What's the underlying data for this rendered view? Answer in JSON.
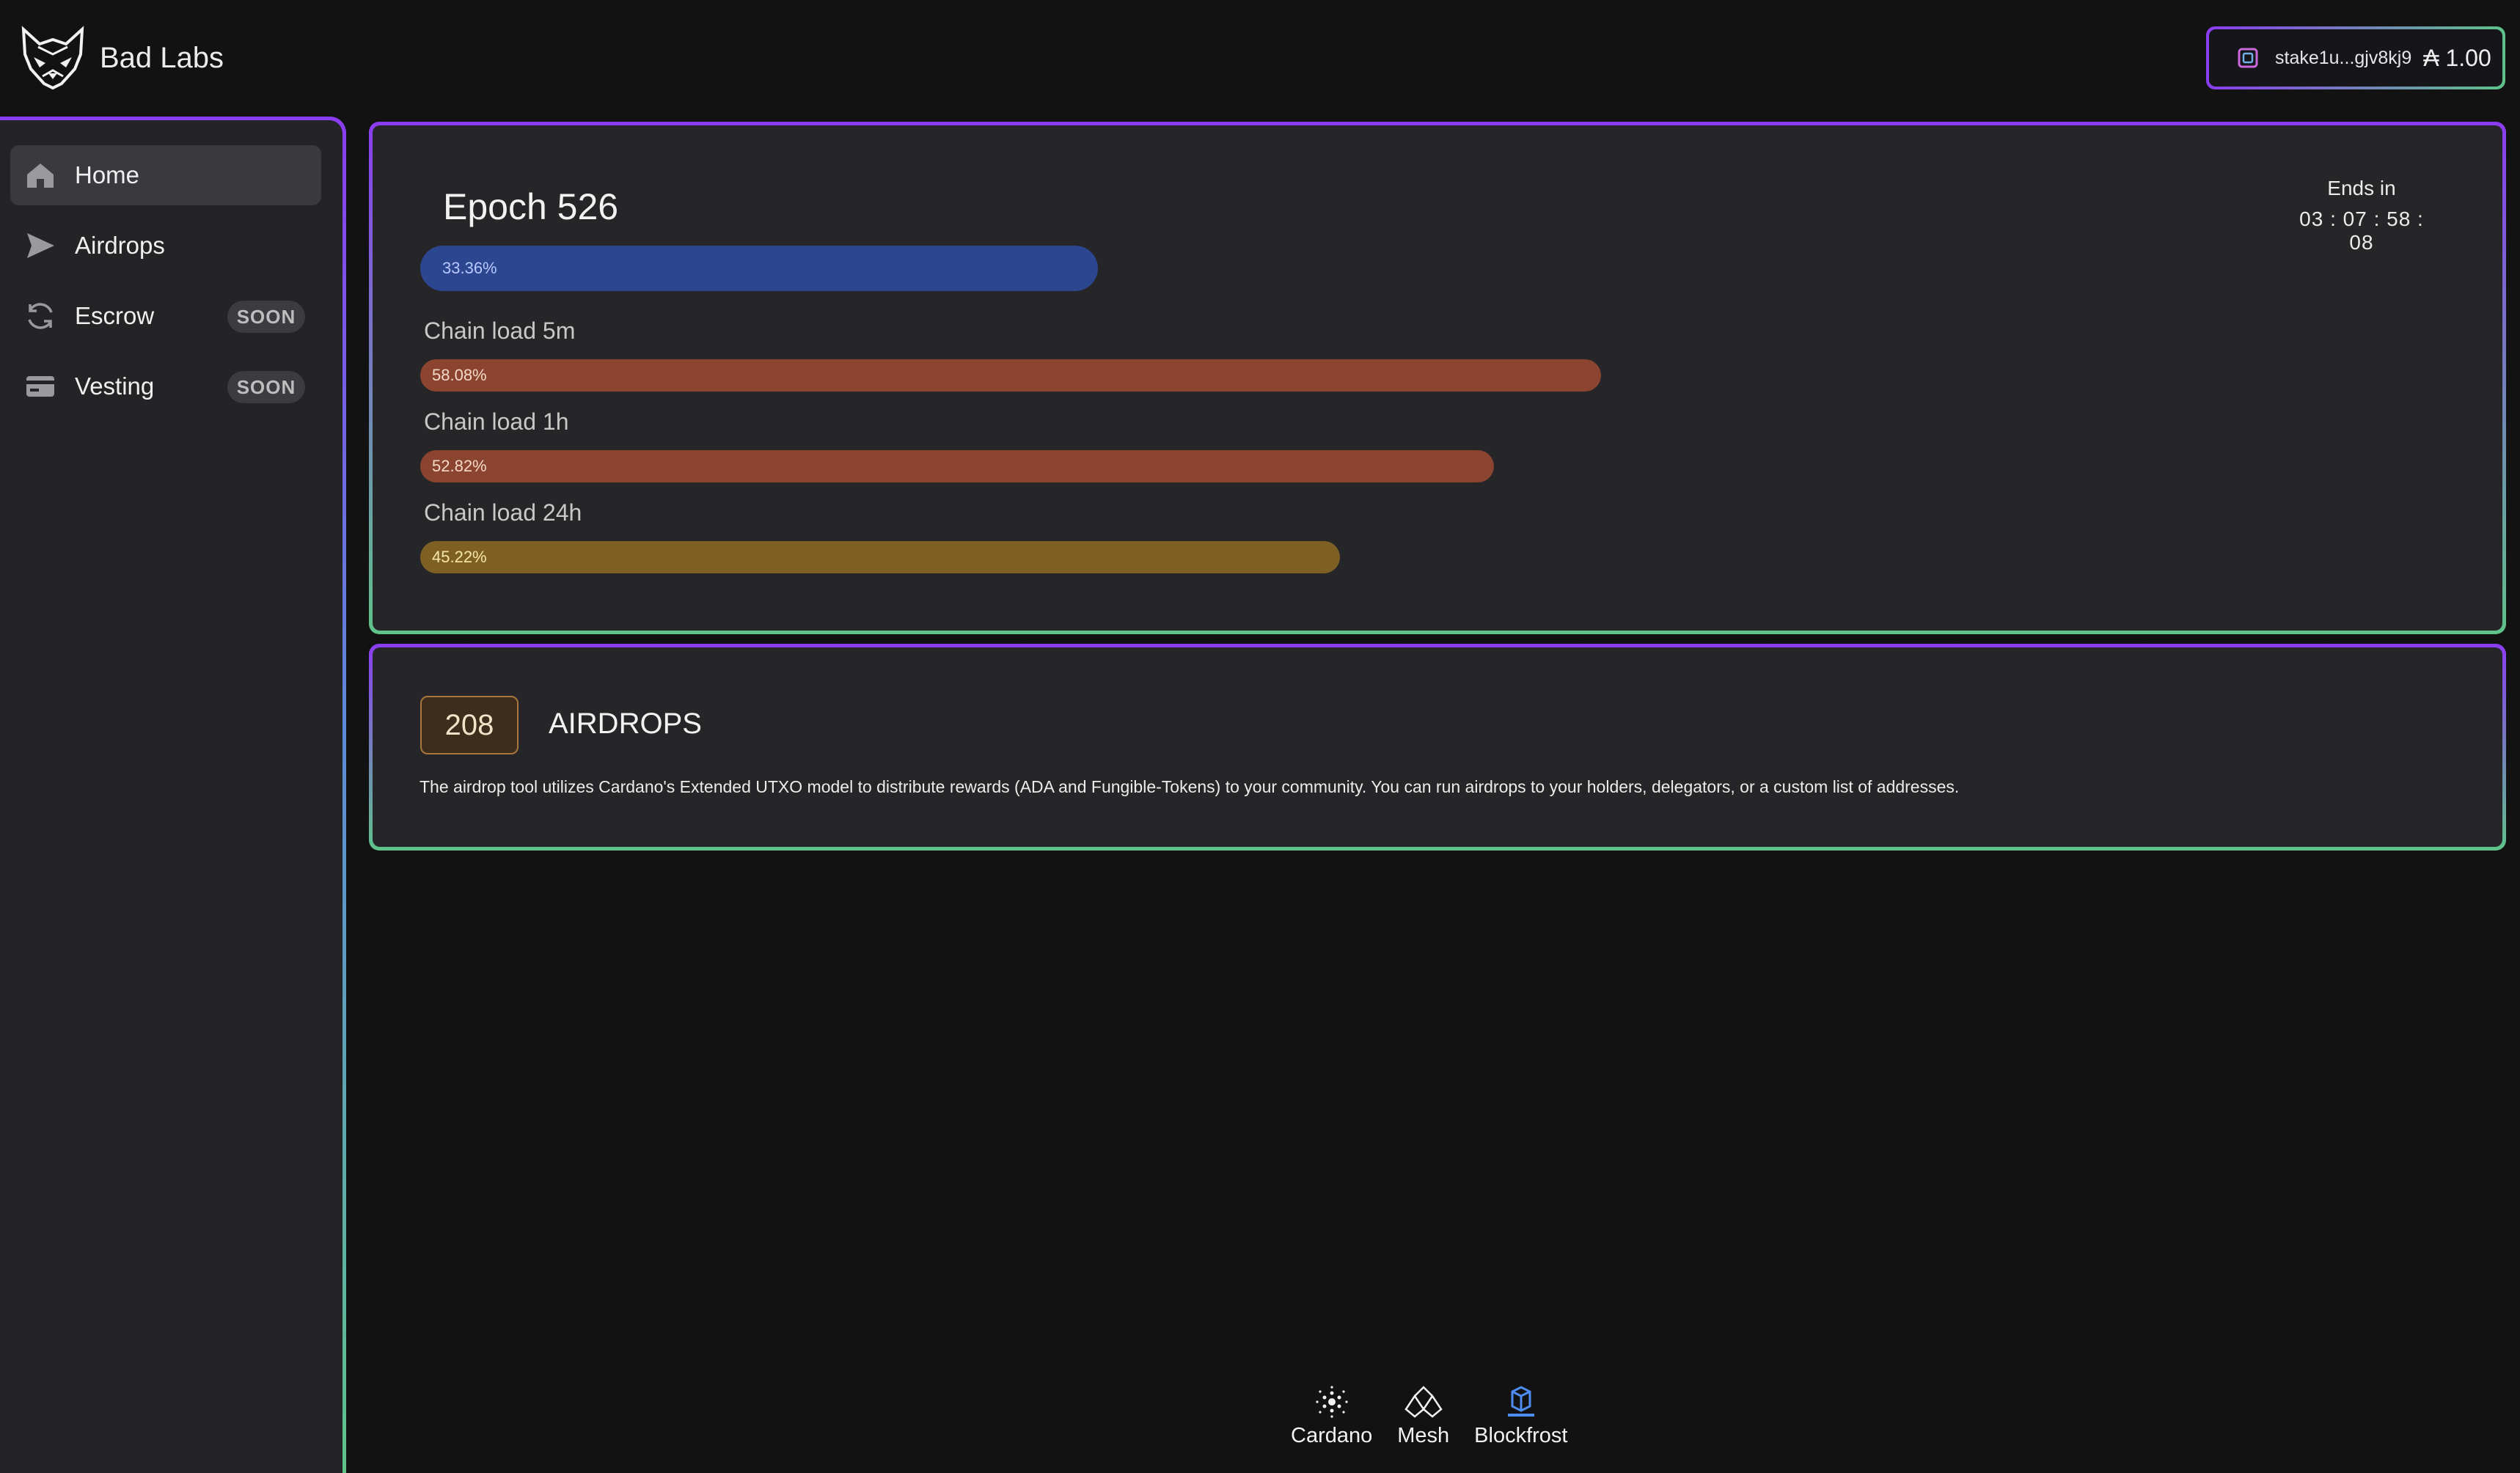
{
  "brand": {
    "name": "Bad Labs"
  },
  "wallet": {
    "stake": "stake1u...gjv8kj9",
    "balance": "₳ 1.00"
  },
  "sidebar": {
    "items": [
      {
        "label": "Home",
        "icon": "home-icon",
        "active": true
      },
      {
        "label": "Airdrops",
        "icon": "send-icon"
      },
      {
        "label": "Escrow",
        "icon": "refresh-icon",
        "badge": "SOON"
      },
      {
        "label": "Vesting",
        "icon": "card-icon",
        "badge": "SOON"
      }
    ]
  },
  "epoch": {
    "title": "Epoch 526",
    "ends_label": "Ends in",
    "ends_time": "03 : 07 : 58 : 08",
    "progress": "33.36%",
    "progress_value": 33.36,
    "accent": "#2c4690"
  },
  "chain_load": [
    {
      "label": "Chain load 5m",
      "value_text": "58.08%",
      "value": 58.08,
      "color": "#8a4430"
    },
    {
      "label": "Chain load 1h",
      "value_text": "52.82%",
      "value": 52.82,
      "color": "#8a4430"
    },
    {
      "label": "Chain load 24h",
      "value_text": "45.22%",
      "value": 45.22,
      "color": "#7f6024"
    }
  ],
  "airdrops": {
    "count": "208",
    "title": "AIRDROPS",
    "description": "The airdrop tool utilizes Cardano's Extended UTXO model to distribute rewards (ADA and Fungible-Tokens) to your community. You can run airdrops to your holders, delegators, or a custom list of addresses."
  },
  "footer": {
    "links": [
      {
        "label": "Cardano",
        "icon": "cardano-icon"
      },
      {
        "label": "Mesh",
        "icon": "mesh-icon"
      },
      {
        "label": "Blockfrost",
        "icon": "blockfrost-icon"
      }
    ]
  }
}
